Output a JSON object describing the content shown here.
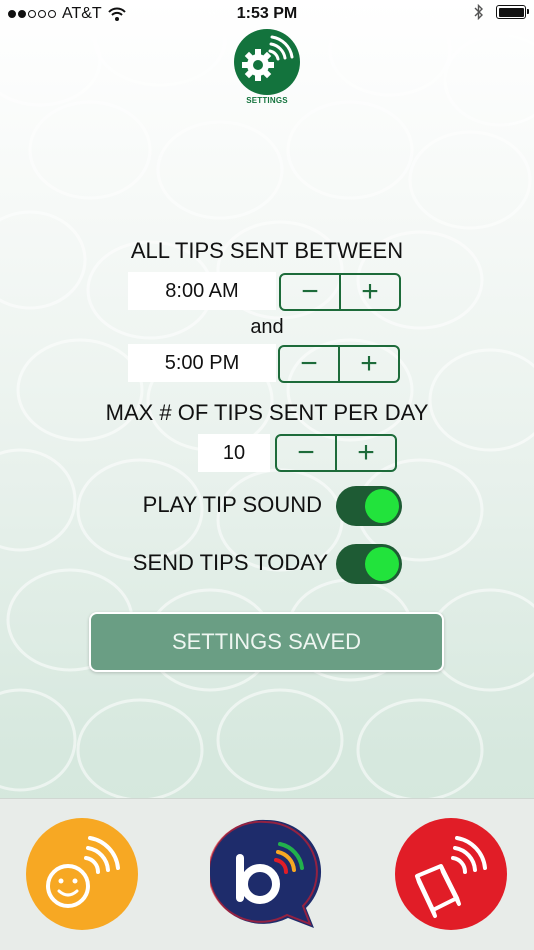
{
  "status_bar": {
    "carrier": "AT&T",
    "time": "1:53 PM",
    "signal_bars_filled": 2,
    "signal_bars_total": 5,
    "icons": [
      "wifi-icon",
      "bluetooth-icon",
      "battery-icon"
    ]
  },
  "header": {
    "caption": "SETTINGS",
    "icon": "gear-broadcast-icon",
    "color": "#13733d"
  },
  "schedule": {
    "heading": "ALL TIPS SENT BETWEEN",
    "start_time": "8:00 AM",
    "connector": "and",
    "end_time": "5:00 PM"
  },
  "max_tips": {
    "heading": "MAX # OF TIPS SENT PER DAY",
    "value": "10"
  },
  "stepper": {
    "minus": "−",
    "plus": "+"
  },
  "toggles": [
    {
      "label": "PLAY TIP SOUND",
      "on": true
    },
    {
      "label": "SEND TIPS TODAY",
      "on": true
    }
  ],
  "saved_button": {
    "label": "SETTINGS SAVED"
  },
  "bottom_tabs": [
    {
      "name": "smiley-broadcast-icon",
      "color": "#f7a823"
    },
    {
      "name": "b-chat-logo-icon",
      "color": "#1e2c6b"
    },
    {
      "name": "book-broadcast-icon",
      "color": "#e11d27"
    }
  ],
  "colors": {
    "accent_green": "#13733d",
    "toggle_track": "#1e5b34",
    "toggle_knob": "#22e33c",
    "saved_button": "#6a9e84"
  }
}
